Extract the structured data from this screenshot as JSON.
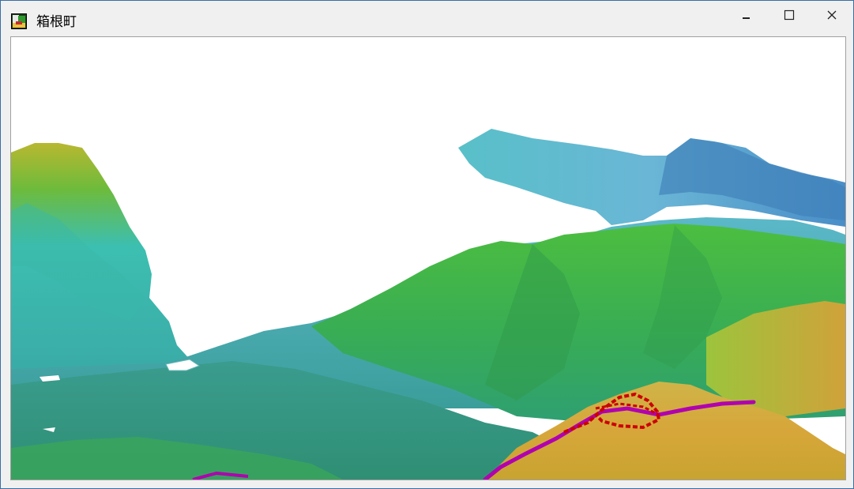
{
  "window": {
    "title": "箱根町",
    "icon": "map-app-icon",
    "controls": {
      "minimize_icon": "minimize-icon",
      "maximize_icon": "maximize-icon",
      "close_icon": "close-icon"
    }
  },
  "viewport": {
    "content": "3d-terrain-view",
    "colors": {
      "background": "#ffffff",
      "low_elevation": "#3cc8c0",
      "mid_elevation": "#3db844",
      "high_elevation": "#d8a838",
      "route_line": "#b000b0",
      "boundary_line": "#cc0000"
    }
  }
}
